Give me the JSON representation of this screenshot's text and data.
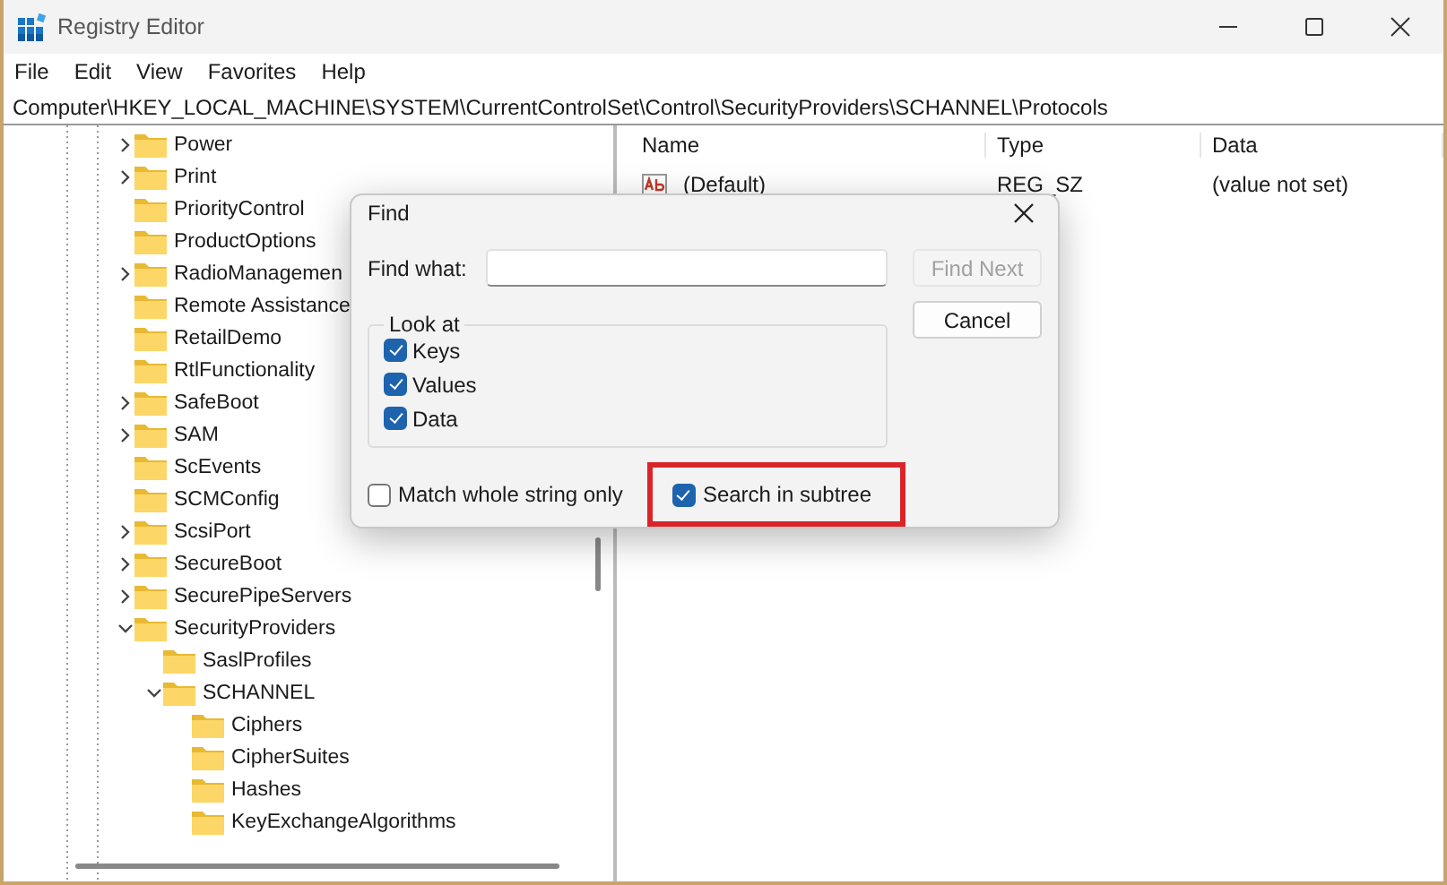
{
  "window": {
    "title": "Registry Editor"
  },
  "menu": [
    "File",
    "Edit",
    "View",
    "Favorites",
    "Help"
  ],
  "address": "Computer\\HKEY_LOCAL_MACHINE\\SYSTEM\\CurrentControlSet\\Control\\SecurityProviders\\SCHANNEL\\Protocols",
  "tree": [
    {
      "label": "Power",
      "expanded": false
    },
    {
      "label": "Print",
      "expanded": false
    },
    {
      "label": "PriorityControl"
    },
    {
      "label": "ProductOptions"
    },
    {
      "label": "RadioManagemen",
      "expanded": false
    },
    {
      "label": "Remote Assistance"
    },
    {
      "label": "RetailDemo"
    },
    {
      "label": "RtlFunctionality"
    },
    {
      "label": "SafeBoot",
      "expanded": false
    },
    {
      "label": "SAM",
      "expanded": false
    },
    {
      "label": "ScEvents"
    },
    {
      "label": "SCMConfig"
    },
    {
      "label": "ScsiPort",
      "expanded": false
    },
    {
      "label": "SecureBoot",
      "expanded": false
    },
    {
      "label": "SecurePipeServers",
      "expanded": false
    },
    {
      "label": "SecurityProviders",
      "expanded": true,
      "children": [
        {
          "label": "SaslProfiles"
        },
        {
          "label": "SCHANNEL",
          "expanded": true,
          "children": [
            {
              "label": "Ciphers"
            },
            {
              "label": "CipherSuites"
            },
            {
              "label": "Hashes"
            },
            {
              "label": "KeyExchangeAlgorithms"
            }
          ]
        }
      ]
    }
  ],
  "values": {
    "columns": [
      "Name",
      "Type",
      "Data"
    ],
    "rows": [
      {
        "name": "(Default)",
        "type": "REG_SZ",
        "data": "(value not set)"
      }
    ]
  },
  "find_dialog": {
    "title": "Find",
    "find_what_label": "Find what:",
    "buttons": [
      {
        "label": "Find Next",
        "disabled": true
      },
      {
        "label": "Cancel",
        "disabled": false
      }
    ],
    "look_at": {
      "label": "Look at",
      "options": [
        {
          "label": "Keys",
          "checked": true
        },
        {
          "label": "Values",
          "checked": true
        },
        {
          "label": "Data",
          "checked": true
        }
      ]
    },
    "options": [
      {
        "label": "Match whole string only",
        "checked": false,
        "highlighted": false
      },
      {
        "label": "Search in subtree",
        "checked": true,
        "highlighted": true
      }
    ]
  }
}
